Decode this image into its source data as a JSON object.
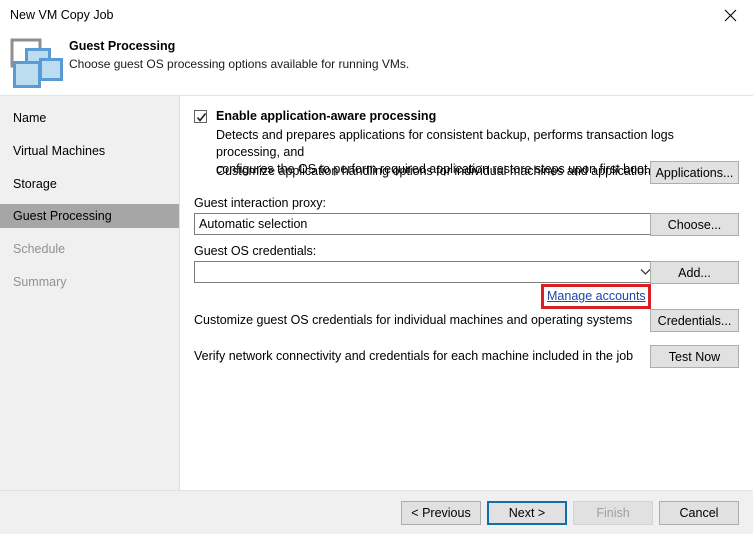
{
  "window": {
    "title": "New VM Copy Job",
    "close_icon": "close-icon"
  },
  "header": {
    "icon": "virtual-machines-icon",
    "title": "Guest Processing",
    "subtitle": "Choose guest OS processing options available for running VMs."
  },
  "sidebar": {
    "items": [
      {
        "label": "Name",
        "state": "normal"
      },
      {
        "label": "Virtual Machines",
        "state": "normal"
      },
      {
        "label": "Storage",
        "state": "normal"
      },
      {
        "label": "Guest Processing",
        "state": "selected"
      },
      {
        "label": "Schedule",
        "state": "disabled"
      },
      {
        "label": "Summary",
        "state": "disabled"
      }
    ]
  },
  "main": {
    "app_aware": {
      "checkbox_label": "Enable application-aware processing",
      "checked": true,
      "description_line1": "Detects and prepares applications for consistent backup, performs transaction logs processing, and",
      "description_line2": "configures the OS to perform required application restore steps upon first boot."
    },
    "customize_apps": {
      "text": "Customize application handling options for individual machines and applications",
      "button": "Applications..."
    },
    "guest_interaction_proxy": {
      "label": "Guest interaction proxy:",
      "value": "Automatic selection",
      "button": "Choose..."
    },
    "guest_os_credentials": {
      "label": "Guest OS credentials:",
      "value": "",
      "placeholder": "",
      "dropdown_icon": "chevron-down-icon",
      "button": "Add...",
      "manage_link": "Manage accounts"
    },
    "customize_credentials": {
      "text": "Customize guest OS credentials for individual machines and operating systems",
      "button": "Credentials..."
    },
    "verify_connectivity": {
      "text": "Verify network connectivity and credentials for each machine included in the job",
      "button": "Test Now"
    }
  },
  "footer": {
    "previous": "< Previous",
    "next": "Next >",
    "finish": "Finish",
    "cancel": "Cancel",
    "finish_disabled": true,
    "next_focused": true
  },
  "colors": {
    "highlight_red": "#d81f21",
    "link_blue": "#1c46a8",
    "focus_blue": "#0f6fa8",
    "sidebar_bg": "#f0f0f0",
    "selected_bg": "#a6a6a6",
    "icon_blue": "#5b9bd5"
  }
}
